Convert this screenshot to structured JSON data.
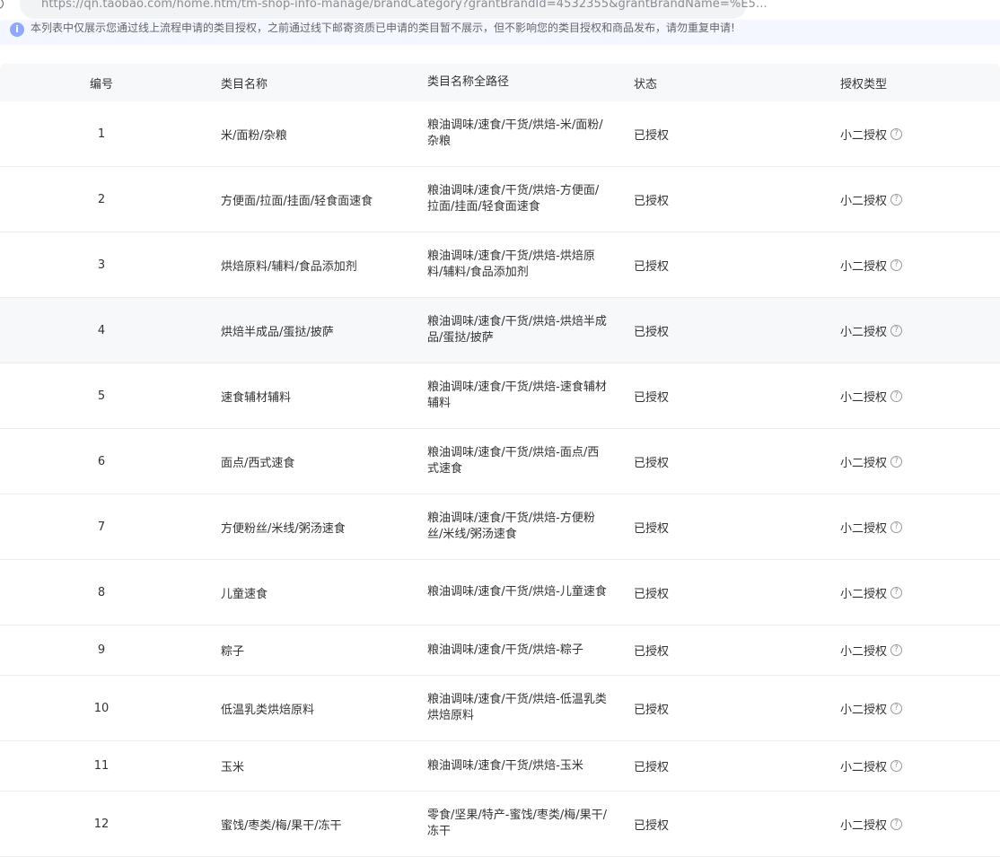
{
  "browser": {
    "url": "https://qn.taobao.com/home.htm/tm-shop-info-manage/brandCategory?grantBrandId=4532355&grantBrandName=%E5..."
  },
  "notice": {
    "text": "本列表中仅展示您通过线上流程申请的类目授权，之前通过线下邮寄资质已申请的类目暂不展示，但不影响您的类目授权和商品发布，请勿重复申请!"
  },
  "table": {
    "headers": {
      "no": "编号",
      "name": "类目名称",
      "path": "类目名称全路径",
      "status": "状态",
      "type": "授权类型"
    },
    "rows": [
      {
        "no": "1",
        "name": "米/面粉/杂粮",
        "path": "粮油调味/速食/干货/烘焙-米/面粉/杂粮",
        "status": "已授权",
        "type": "小二授权"
      },
      {
        "no": "2",
        "name": "方便面/拉面/挂面/轻食面速食",
        "path": "粮油调味/速食/干货/烘焙-方便面/拉面/挂面/轻食面速食",
        "status": "已授权",
        "type": "小二授权"
      },
      {
        "no": "3",
        "name": "烘焙原料/辅料/食品添加剂",
        "path": "粮油调味/速食/干货/烘焙-烘焙原料/辅料/食品添加剂",
        "status": "已授权",
        "type": "小二授权"
      },
      {
        "no": "4",
        "name": "烘焙半成品/蛋挞/披萨",
        "path": "粮油调味/速食/干货/烘焙-烘焙半成品/蛋挞/披萨",
        "status": "已授权",
        "type": "小二授权"
      },
      {
        "no": "5",
        "name": "速食辅材辅料",
        "path": "粮油调味/速食/干货/烘焙-速食辅材辅料",
        "status": "已授权",
        "type": "小二授权"
      },
      {
        "no": "6",
        "name": "面点/西式速食",
        "path": "粮油调味/速食/干货/烘焙-面点/西式速食",
        "status": "已授权",
        "type": "小二授权"
      },
      {
        "no": "7",
        "name": "方便粉丝/米线/粥汤速食",
        "path": "粮油调味/速食/干货/烘焙-方便粉丝/米线/粥汤速食",
        "status": "已授权",
        "type": "小二授权"
      },
      {
        "no": "8",
        "name": "儿童速食",
        "path": "粮油调味/速食/干货/烘焙-儿童速食",
        "status": "已授权",
        "type": "小二授权"
      },
      {
        "no": "9",
        "name": "粽子",
        "path": "粮油调味/速食/干货/烘焙-粽子",
        "status": "已授权",
        "type": "小二授权"
      },
      {
        "no": "10",
        "name": "低温乳类烘焙原料",
        "path": "粮油调味/速食/干货/烘焙-低温乳类烘焙原料",
        "status": "已授权",
        "type": "小二授权"
      },
      {
        "no": "11",
        "name": "玉米",
        "path": "粮油调味/速食/干货/烘焙-玉米",
        "status": "已授权",
        "type": "小二授权"
      },
      {
        "no": "12",
        "name": "蜜饯/枣类/梅/果干/冻干",
        "path": "零食/坚果/特产-蜜饯/枣类/梅/果干/冻干",
        "status": "已授权",
        "type": "小二授权"
      }
    ]
  },
  "icons": {
    "search": "search-icon",
    "info": "info-icon",
    "help": "help-icon"
  }
}
